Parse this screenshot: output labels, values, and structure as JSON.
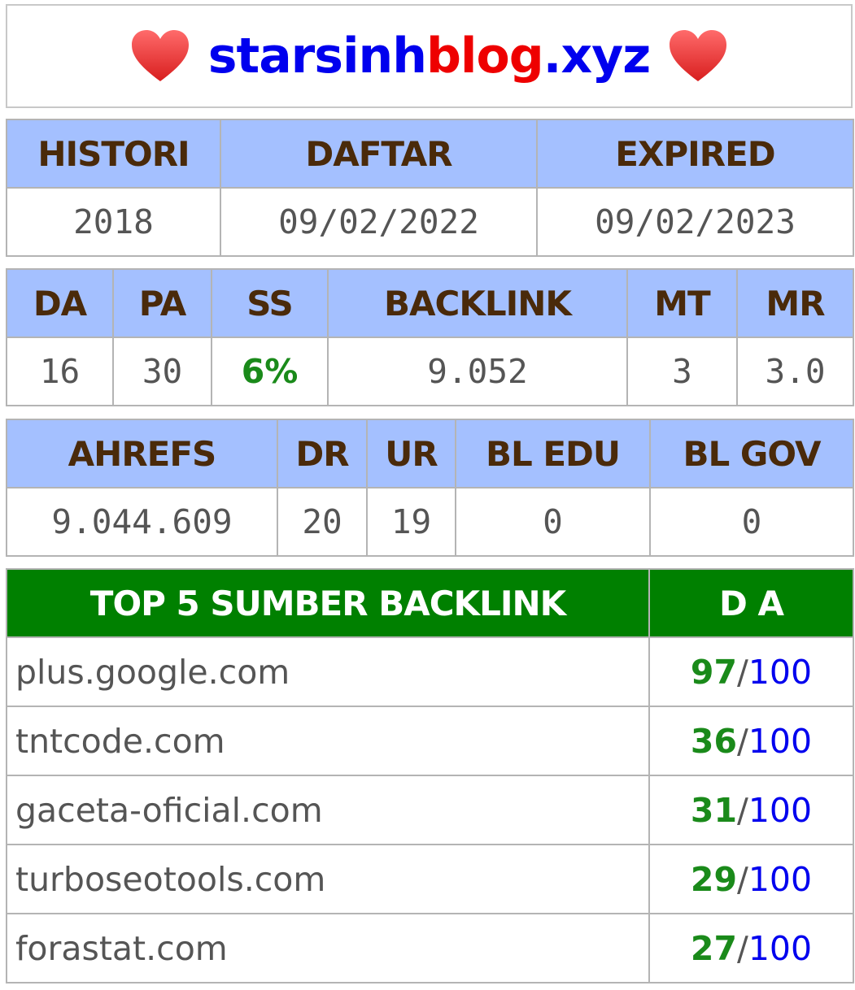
{
  "header": {
    "title_part1": "starsinh",
    "title_part2": "blog",
    "title_part3": ".xyz",
    "icon_left": "heart-icon",
    "icon_right": "heart-icon",
    "colors": {
      "blue": "#0000ee",
      "red": "#ee0000"
    }
  },
  "domain_info": {
    "headers": [
      "HISTORI",
      "DAFTAR",
      "EXPIRED"
    ],
    "values": [
      "2018",
      "09/02/2022",
      "09/02/2023"
    ]
  },
  "moz": {
    "headers": [
      "DA",
      "PA",
      "SS",
      "BACKLINK",
      "MT",
      "MR"
    ],
    "values": [
      "16",
      "30",
      "6%",
      "9.052",
      "3",
      "3.0"
    ]
  },
  "ahrefs": {
    "headers": [
      "AHREFS",
      "DR",
      "UR",
      "BL EDU",
      "BL GOV"
    ],
    "values": [
      "9.044.609",
      "20",
      "19",
      "0",
      "0"
    ]
  },
  "top_sources": {
    "header_source": "TOP 5 SUMBER BACKLINK",
    "header_da": "D A",
    "max_label": "100",
    "rows": [
      {
        "domain": "plus.google.com",
        "da": "97"
      },
      {
        "domain": "tntcode.com",
        "da": "36"
      },
      {
        "domain": "gaceta-oficial.com",
        "da": "31"
      },
      {
        "domain": "turboseotools.com",
        "da": "29"
      },
      {
        "domain": "forastat.com",
        "da": "27"
      }
    ]
  }
}
